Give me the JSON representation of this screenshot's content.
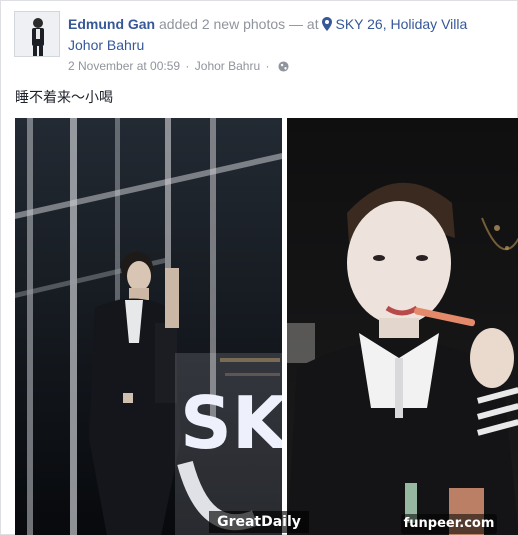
{
  "post": {
    "author": "Edmund Gan",
    "action": "added 2 new photos",
    "at_sep": "— at",
    "place_line1": "SKY 26, Holiday Villa",
    "place_line2": "Johor Bahru",
    "timestamp": "2 November at 00:59",
    "meta_sep": "·",
    "location": "Johor Bahru",
    "meta_sep2": "·",
    "text": "睡不着来～小喝",
    "icons": {
      "pin": "map-pin-icon",
      "audience": "globe-icon"
    },
    "photos": [
      {
        "name": "photo-left",
        "sign_text": "SKY"
      },
      {
        "name": "photo-right"
      }
    ]
  },
  "watermarks": {
    "left": "GreatDaily",
    "right": "funpeer.com"
  },
  "colors": {
    "link": "#365899",
    "meta": "#90949c",
    "text": "#1d2129"
  }
}
